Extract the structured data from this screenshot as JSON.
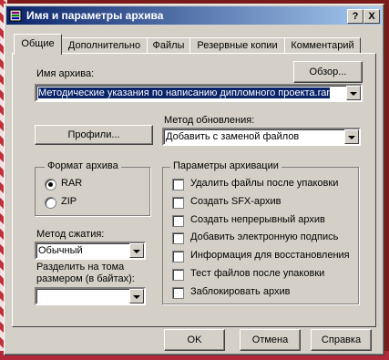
{
  "title": "Имя и параметры архива",
  "title_buttons": [
    "?",
    "X"
  ],
  "tabs": [
    "Общие",
    "Дополнительно",
    "Файлы",
    "Резервные копии",
    "Комментарий"
  ],
  "archive_name": {
    "label": "Имя архива:",
    "browse": "Обзор...",
    "value": "Методические указания по написанию дипломного проекта.rar"
  },
  "profiles_button": "Профили...",
  "update_method": {
    "label": "Метод обновления:",
    "value": "Добавить с заменой файлов"
  },
  "format": {
    "label": "Формат архива",
    "options": [
      "RAR",
      "ZIP"
    ],
    "selected": "RAR"
  },
  "archive_options": {
    "label": "Параметры архивации",
    "items": [
      "Удалить файлы после упаковки",
      "Создать SFX-архив",
      "Создать непрерывный архив",
      "Добавить электронную подпись",
      "Информация для восстановления",
      "Тест файлов после упаковки",
      "Заблокировать архив"
    ]
  },
  "compression": {
    "label": "Метод сжатия:",
    "value": "Обычный"
  },
  "split": {
    "label_line1": "Разделить на тома",
    "label_line2": "размером (в байтах):",
    "value": ""
  },
  "buttons": {
    "ok": "OK",
    "cancel": "Отмена",
    "help": "Справка"
  }
}
